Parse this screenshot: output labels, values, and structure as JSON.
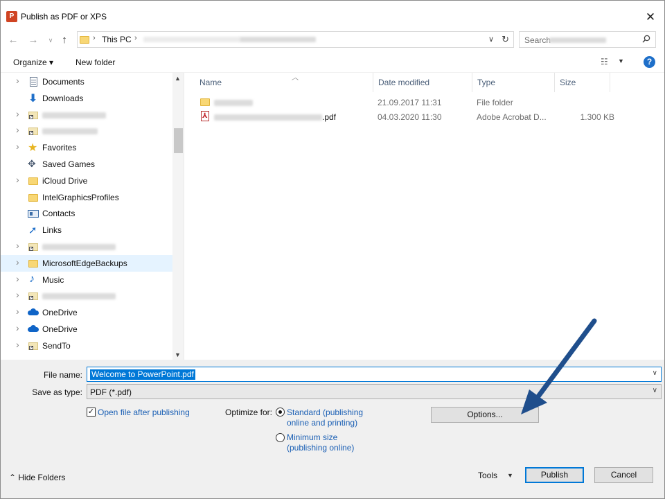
{
  "window": {
    "title": "Publish as PDF or XPS",
    "app_icon": "P"
  },
  "address": {
    "root": "This PC",
    "search_placeholder": "Search"
  },
  "toolbar": {
    "organize": "Organize ▾",
    "new_folder": "New folder",
    "help": "?"
  },
  "tree": [
    {
      "label": "Documents",
      "icon": "documents-icon",
      "expander": true
    },
    {
      "label": "Downloads",
      "icon": "downloads-icon",
      "expander": false
    },
    {
      "label": "",
      "icon": "shortcut-folder-icon",
      "expander": true,
      "blurred": true
    },
    {
      "label": "",
      "icon": "shortcut-folder-icon",
      "expander": true,
      "blurred": true
    },
    {
      "label": "Favorites",
      "icon": "star-icon",
      "expander": true
    },
    {
      "label": "Saved Games",
      "icon": "saved-games-icon",
      "expander": false
    },
    {
      "label": "iCloud Drive",
      "icon": "folder-icon",
      "expander": true
    },
    {
      "label": "IntelGraphicsProfiles",
      "icon": "folder-icon",
      "expander": false
    },
    {
      "label": "Contacts",
      "icon": "contacts-icon",
      "expander": false
    },
    {
      "label": "Links",
      "icon": "links-icon",
      "expander": false
    },
    {
      "label": "",
      "icon": "shortcut-folder-icon",
      "expander": true,
      "blurred": true
    },
    {
      "label": "MicrosoftEdgeBackups",
      "icon": "folder-icon",
      "expander": true,
      "selected": true
    },
    {
      "label": "Music",
      "icon": "music-icon",
      "expander": true
    },
    {
      "label": "",
      "icon": "shortcut-folder-icon",
      "expander": true,
      "blurred": true
    },
    {
      "label": "OneDrive",
      "icon": "onedrive-icon",
      "expander": true
    },
    {
      "label": "OneDrive",
      "icon": "onedrive-icon",
      "expander": true
    },
    {
      "label": "SendTo",
      "icon": "shortcut-folder-icon",
      "expander": true
    }
  ],
  "columns": {
    "name": "Name",
    "date": "Date modified",
    "type": "Type",
    "size": "Size"
  },
  "files": [
    {
      "name": "",
      "date": "21.09.2017 11:31",
      "type": "File folder",
      "size": "",
      "icon": "folder-icon"
    },
    {
      "name": ".pdf",
      "date": "04.03.2020 11:30",
      "type": "Adobe Acrobat D...",
      "size": "1.300 KB",
      "icon": "pdf-icon"
    }
  ],
  "form": {
    "file_name_label": "File name:",
    "file_name_value": "Welcome to PowerPoint.pdf",
    "save_type_label": "Save as type:",
    "save_type_value": "PDF (*.pdf)",
    "open_after_label": "Open file after publishing",
    "optimize_label": "Optimize for:",
    "standard_line1": "Standard (publishing",
    "standard_line2": "online and printing)",
    "minimum_line1": "Minimum size",
    "minimum_line2": "(publishing online)",
    "options_button": "Options..."
  },
  "footer": {
    "hide_folders": "Hide Folders",
    "tools": "Tools",
    "publish": "Publish",
    "cancel": "Cancel"
  },
  "colors": {
    "accent": "#0078d7",
    "link": "#1a5fb4",
    "annotation_arrow": "#1f4e8c"
  }
}
